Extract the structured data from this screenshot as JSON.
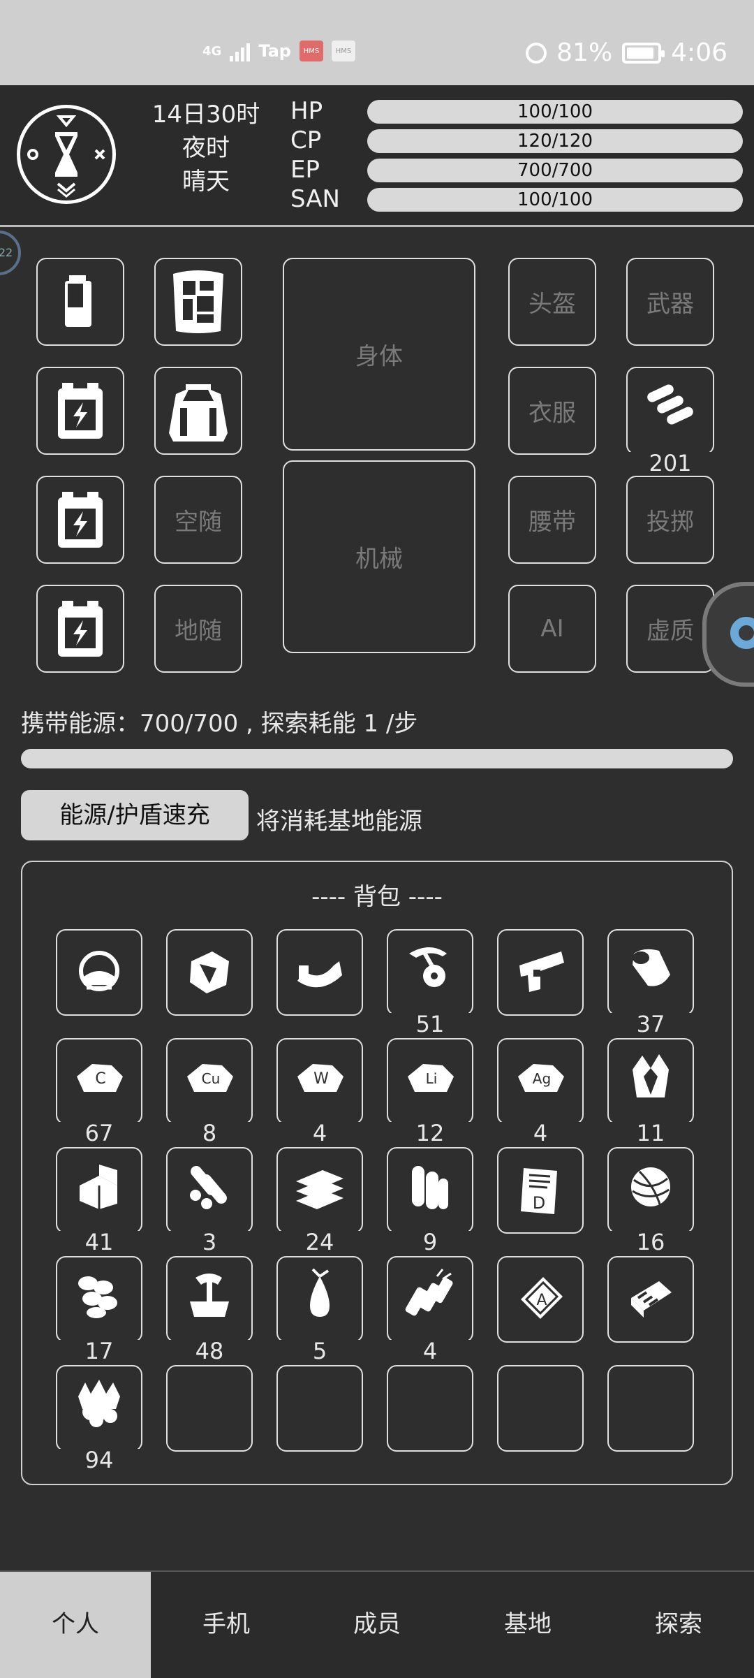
{
  "status_bar": {
    "network": "4G",
    "tap_label": "Tap",
    "hms_label": "HMS",
    "battery_percent": "81%",
    "time": "4:06",
    "icons": [
      "signal-icon",
      "tap-icon",
      "hms-icon",
      "alarm-icon",
      "battery-icon"
    ]
  },
  "header": {
    "day": "14日30时",
    "period": "夜时",
    "weather": "晴天",
    "stats": [
      {
        "label": "HP",
        "value": "100/100"
      },
      {
        "label": "CP",
        "value": "120/120"
      },
      {
        "label": "EP",
        "value": "700/700"
      },
      {
        "label": "SAN",
        "value": "100/100"
      }
    ]
  },
  "side_tab": {
    "label": "22"
  },
  "equipment": {
    "left_col1": [
      {
        "icon": "battery-icon"
      },
      {
        "icon": "energy-cell-icon"
      },
      {
        "icon": "energy-cell-icon"
      },
      {
        "icon": "energy-cell-icon"
      }
    ],
    "left_col2": [
      {
        "icon": "armor-plate-icon"
      },
      {
        "icon": "backpack-icon"
      },
      {
        "label": "空随"
      },
      {
        "label": "地随"
      }
    ],
    "center": [
      {
        "label": "身体"
      },
      {
        "label": "机械"
      }
    ],
    "right_col1": [
      {
        "label": "头盔"
      },
      {
        "label": "衣服"
      },
      {
        "label": "腰带"
      },
      {
        "label": "AI"
      }
    ],
    "right_col2": [
      {
        "label": "武器"
      },
      {
        "icon": "ammo-icon",
        "count": "201"
      },
      {
        "label": "投掷"
      },
      {
        "label": "虚质"
      }
    ]
  },
  "energy": {
    "text": "携带能源：700/700 , 探索耗能 1 /步",
    "fill_fraction": 1.0
  },
  "recharge": {
    "button_label": "能源/护盾速充",
    "note": "将消耗基地能源"
  },
  "backpack": {
    "title": "---- 背包 ----",
    "items": [
      {
        "icon": "helmet-icon",
        "count": ""
      },
      {
        "icon": "ore-chunk-icon",
        "count": ""
      },
      {
        "icon": "belt-icon",
        "count": ""
      },
      {
        "icon": "pickaxe-gear-icon",
        "count": "51"
      },
      {
        "icon": "pistol-icon",
        "count": ""
      },
      {
        "icon": "wood-log-icon",
        "count": "37"
      },
      {
        "icon": "carbon-ore-icon",
        "ore": "C",
        "count": "67"
      },
      {
        "icon": "copper-ore-icon",
        "ore": "Cu",
        "count": "8"
      },
      {
        "icon": "tungsten-ore-icon",
        "ore": "W",
        "count": "4"
      },
      {
        "icon": "lithium-ore-icon",
        "ore": "Li",
        "count": "12"
      },
      {
        "icon": "silver-ore-icon",
        "ore": "Ag",
        "count": "4"
      },
      {
        "icon": "crystal-icon",
        "count": "11"
      },
      {
        "icon": "cube-block-icon",
        "count": "41"
      },
      {
        "icon": "pipes-icon",
        "count": "3"
      },
      {
        "icon": "plates-icon",
        "count": "24"
      },
      {
        "icon": "rolls-icon",
        "count": "9"
      },
      {
        "icon": "document-d-icon",
        "count": ""
      },
      {
        "icon": "yarn-ball-icon",
        "count": "16"
      },
      {
        "icon": "rope-icon",
        "count": "17"
      },
      {
        "icon": "axe-stump-icon",
        "count": "48"
      },
      {
        "icon": "fruit-icon",
        "count": "5"
      },
      {
        "icon": "firecracker-icon",
        "count": "4"
      },
      {
        "icon": "card-a-icon",
        "count": ""
      },
      {
        "icon": "battery-pack-icon",
        "count": ""
      },
      {
        "icon": "fire-cloud-icon",
        "count": "94"
      },
      {
        "icon": "empty-slot",
        "count": ""
      },
      {
        "icon": "empty-slot",
        "count": ""
      },
      {
        "icon": "empty-slot",
        "count": ""
      },
      {
        "icon": "empty-slot",
        "count": ""
      },
      {
        "icon": "empty-slot",
        "count": ""
      }
    ]
  },
  "nav": {
    "active_index": 0,
    "tabs": [
      "个人",
      "手机",
      "成员",
      "基地",
      "探索"
    ]
  }
}
